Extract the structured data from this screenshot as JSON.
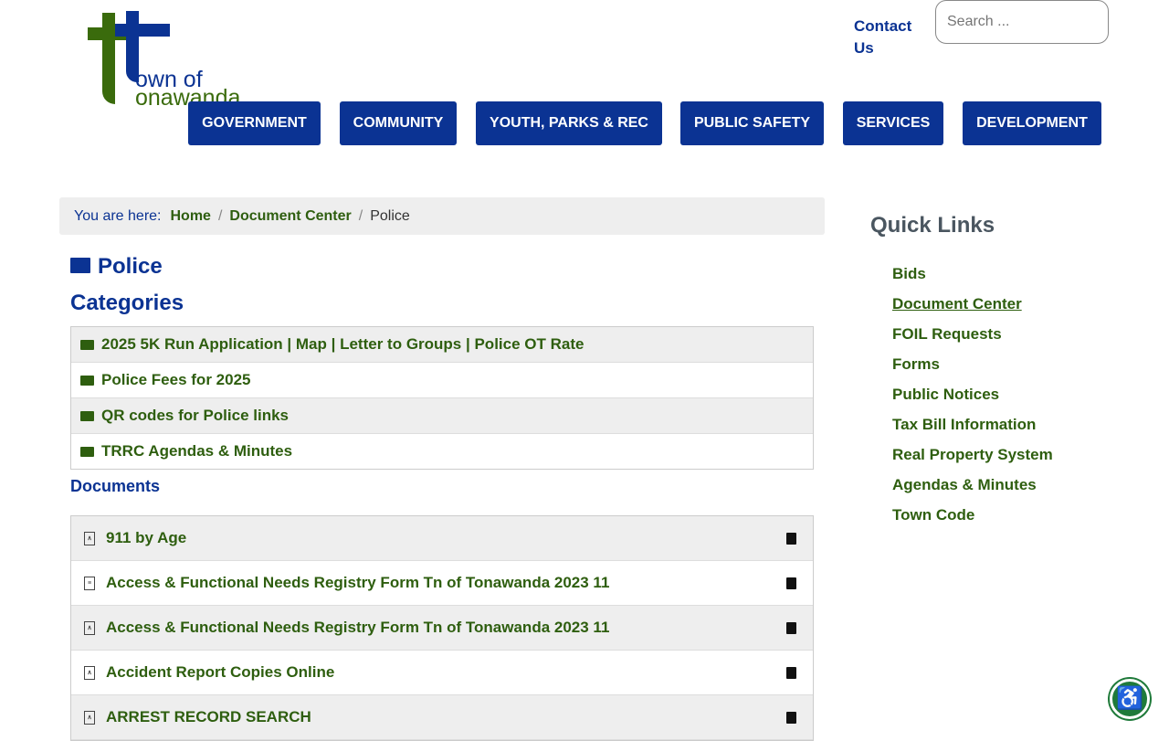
{
  "header": {
    "logo_text": [
      "own of",
      "onawanda"
    ],
    "contact": "Contact Us",
    "search_placeholder": "Search ..."
  },
  "nav": [
    "GOVERNMENT",
    "COMMUNITY",
    "YOUTH, PARKS & REC",
    "PUBLIC SAFETY",
    "SERVICES",
    "DEVELOPMENT"
  ],
  "breadcrumb": {
    "label": "You are here:",
    "items": [
      "Home",
      "Document Center"
    ],
    "current": "Police"
  },
  "page_title": "Police",
  "categories_title": "Categories",
  "categories": [
    "2025 5K Run Application | Map | Letter to Groups | Police OT Rate",
    "Police Fees for 2025",
    "QR codes for Police links",
    "TRRC Agendas & Minutes"
  ],
  "documents_title": "Documents",
  "documents": [
    {
      "name": "911 by Age",
      "type": "pdf"
    },
    {
      "name": "Access & Functional Needs Registry Form Tn of Tonawanda 2023 11",
      "type": "doc"
    },
    {
      "name": "Access & Functional Needs Registry Form Tn of Tonawanda 2023 11",
      "type": "pdf"
    },
    {
      "name": "Accident Report Copies Online",
      "type": "pdf"
    },
    {
      "name": "ARREST RECORD SEARCH",
      "type": "pdf"
    }
  ],
  "quick_links": {
    "title": "Quick Links",
    "items": [
      "Bids",
      "Document Center",
      "FOIL Requests",
      "Forms",
      "Public Notices",
      "Tax Bill Information",
      "Real Property System",
      "Agendas & Minutes",
      "Town Code"
    ]
  },
  "colors": {
    "brand_blue": "#0b3393",
    "brand_green": "#2e5e0f"
  }
}
